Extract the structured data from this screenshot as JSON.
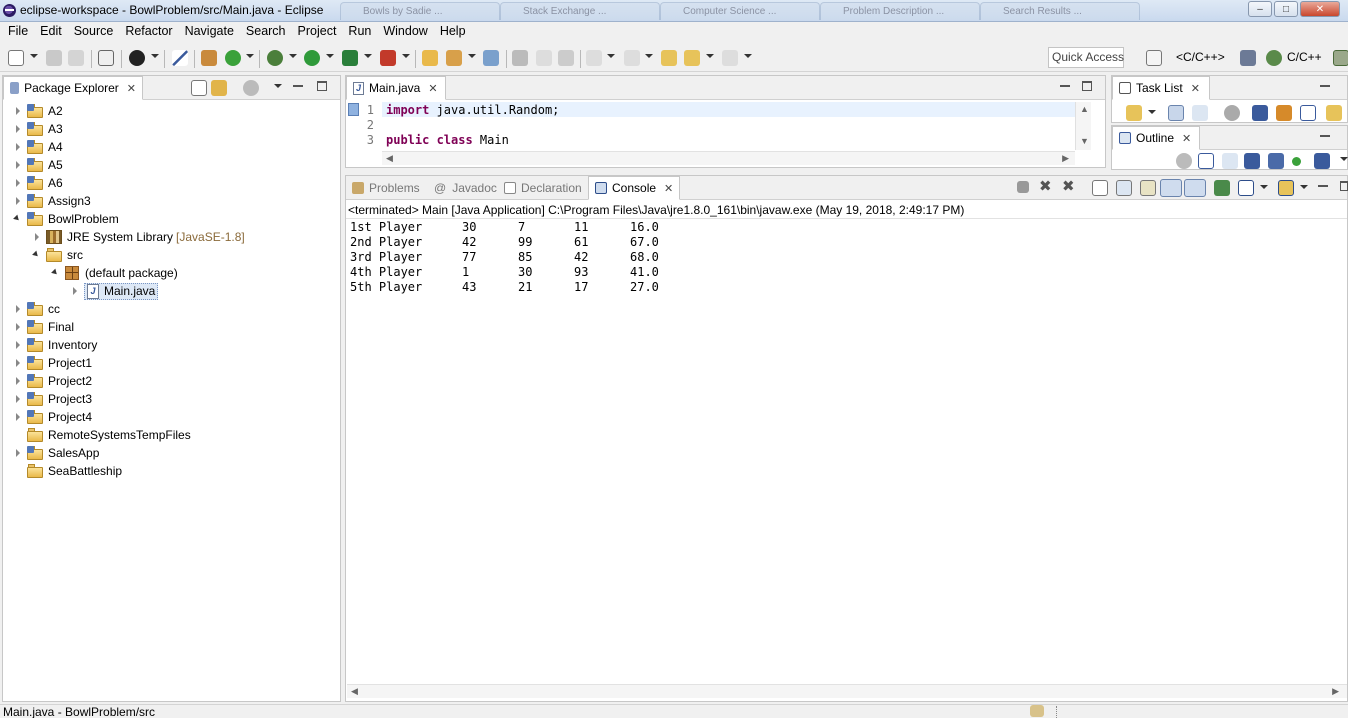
{
  "window": {
    "title": "eclipse-workspace - BowlProblem/src/Main.java - Eclipse",
    "background_tabs": [
      "Bowls by Sadie ...",
      "Stack Exchange ...",
      "Computer Science ...",
      "Problem Description ...",
      "Search Results ..."
    ]
  },
  "menu": [
    "File",
    "Edit",
    "Source",
    "Refactor",
    "Navigate",
    "Search",
    "Project",
    "Run",
    "Window",
    "Help"
  ],
  "toolbar": {
    "quick_access": "Quick Access",
    "perspectives": [
      "<C/C++>",
      "C/C++"
    ]
  },
  "package_explorer": {
    "tab_label": "Package Explorer",
    "items": [
      {
        "label": "A2"
      },
      {
        "label": "A3"
      },
      {
        "label": "A4"
      },
      {
        "label": "A5"
      },
      {
        "label": "A6"
      },
      {
        "label": "Assign3"
      },
      {
        "label": "BowlProblem"
      },
      {
        "label": "JRE System Library",
        "decoration": "[JavaSE-1.8]"
      },
      {
        "label": "src"
      },
      {
        "label": "(default package)"
      },
      {
        "label": "Main.java"
      },
      {
        "label": "cc"
      },
      {
        "label": "Final"
      },
      {
        "label": "Inventory"
      },
      {
        "label": "Project1"
      },
      {
        "label": "Project2"
      },
      {
        "label": "Project3"
      },
      {
        "label": "Project4"
      },
      {
        "label": "RemoteSystemsTempFiles"
      },
      {
        "label": "SalesApp"
      },
      {
        "label": "SeaBattleship"
      }
    ]
  },
  "editor": {
    "tab_label": "Main.java",
    "lines": [
      {
        "num": "1",
        "kw": "import",
        "rest": " java.util.Random;"
      },
      {
        "num": "2",
        "kw": "",
        "rest": ""
      },
      {
        "num": "3",
        "kw": "public class",
        "rest": " Main"
      }
    ]
  },
  "task_list": {
    "tab_label": "Task List"
  },
  "outline": {
    "tab_label": "Outline"
  },
  "bottom_tabs": {
    "problems": "Problems",
    "javadoc": "Javadoc",
    "declaration": "Declaration",
    "console": "Console"
  },
  "console": {
    "header": "<terminated> Main [Java Application] C:\\Program Files\\Java\\jre1.8.0_161\\bin\\javaw.exe (May 19, 2018, 2:49:17 PM)",
    "rows": [
      {
        "name": "1st Player",
        "v1": "30",
        "v2": "7",
        "v3": "11",
        "avg": "16.0"
      },
      {
        "name": "2nd Player",
        "v1": "42",
        "v2": "99",
        "v3": "61",
        "avg": "67.0"
      },
      {
        "name": "3rd Player",
        "v1": "77",
        "v2": "85",
        "v3": "42",
        "avg": "68.0"
      },
      {
        "name": "4th Player",
        "v1": "1",
        "v2": "30",
        "v3": "93",
        "avg": "41.0"
      },
      {
        "name": "5th Player",
        "v1": "43",
        "v2": "21",
        "v3": "17",
        "avg": "27.0"
      }
    ]
  },
  "status_bar": {
    "text": "Main.java - BowlProblem/src"
  }
}
